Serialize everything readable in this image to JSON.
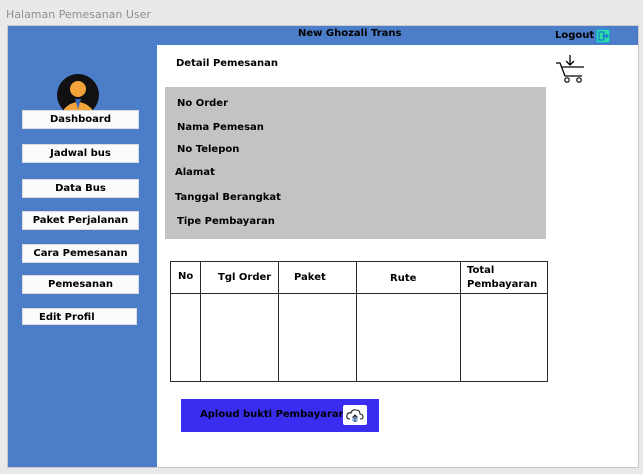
{
  "page_label": "Halaman Pemesanan User",
  "header": {
    "title": "New Ghozali Trans",
    "logout_label": "Logout",
    "logout_icon": "logout-icon"
  },
  "sidebar": {
    "avatar_icon": "user-avatar-icon",
    "items": [
      {
        "label": "Dashboard"
      },
      {
        "label": "Jadwal bus"
      },
      {
        "label": "Data Bus"
      },
      {
        "label": "Paket Perjalanan"
      },
      {
        "label": "Cara Pemesanan"
      },
      {
        "label": "Pemesanan"
      },
      {
        "label": "Edit Profil"
      }
    ]
  },
  "main": {
    "title": "Detail Pemesanan",
    "cart_icon": "cart-icon",
    "detail_fields": [
      "No Order",
      "Nama Pemesan",
      "No Telepon",
      "Alamat",
      "Tanggal Berangkat",
      "Tipe Pembayaran"
    ],
    "table": {
      "columns": [
        "No",
        "Tgl Order",
        "Paket",
        "Rute",
        "Total Pembayaran"
      ],
      "rows": []
    },
    "upload_button_label": "Aploud bukti Pembayaran",
    "upload_icon": "cloud-upload-icon"
  },
  "colors": {
    "header_bg": "#4b7dc8",
    "sidebar_bg": "#4b7dc8",
    "detail_panel_bg": "#c3c3c3",
    "upload_button_bg": "#3a2df0",
    "page_bg": "#e9e9e9"
  }
}
